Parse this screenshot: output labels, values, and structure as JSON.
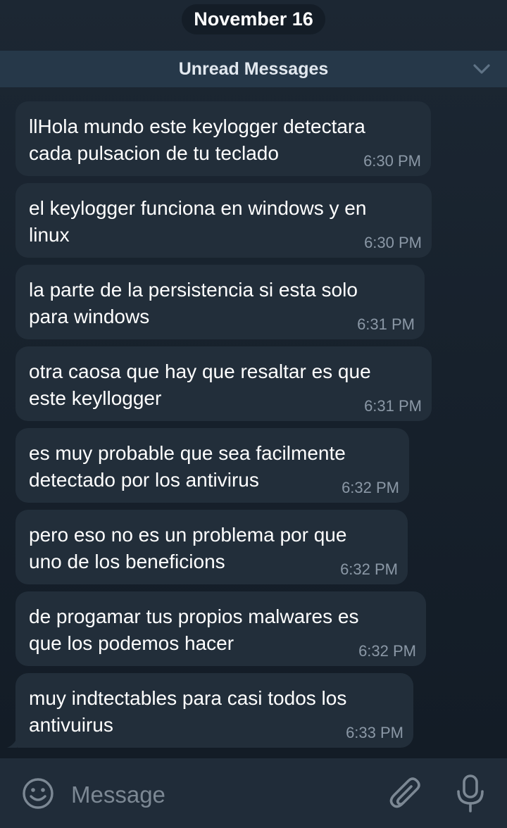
{
  "chat": {
    "date_label": "November 16",
    "unread_label": "Unread Messages",
    "messages": [
      {
        "text": "llHola mundo este keylogger detectara\ncada pulsacion de tu teclado",
        "time": "6:30 PM"
      },
      {
        "text": "el keylogger funciona en windows y en\nlinux",
        "time": "6:30 PM"
      },
      {
        "text": "la parte de la persistencia si esta solo\npara windows",
        "time": "6:31 PM"
      },
      {
        "text": "otra caosa que hay que resaltar es que\neste keyllogger",
        "time": "6:31 PM"
      },
      {
        "text": "es muy probable que sea facilmente\ndetectado por los antivirus",
        "time": "6:32 PM"
      },
      {
        "text": "pero eso no es un problema por que\nuno de los beneficions",
        "time": "6:32 PM"
      },
      {
        "text": "de progamar tus propios malwares es\nque los podemos hacer",
        "time": "6:32 PM"
      },
      {
        "text": "muy indtectables para casi todos los\nantivuirus",
        "time": "6:33 PM"
      }
    ]
  },
  "composer": {
    "placeholder": "Message",
    "icons": {
      "emoji": "emoji-icon",
      "attach": "paperclip-icon",
      "mic": "microphone-icon",
      "chevron": "chevron-down-icon"
    }
  },
  "colors": {
    "background": "#17212c",
    "bubble": "#222e3a",
    "unread_bar": "#263849",
    "composer": "#202c39",
    "timestamp": "#8b98a6"
  }
}
